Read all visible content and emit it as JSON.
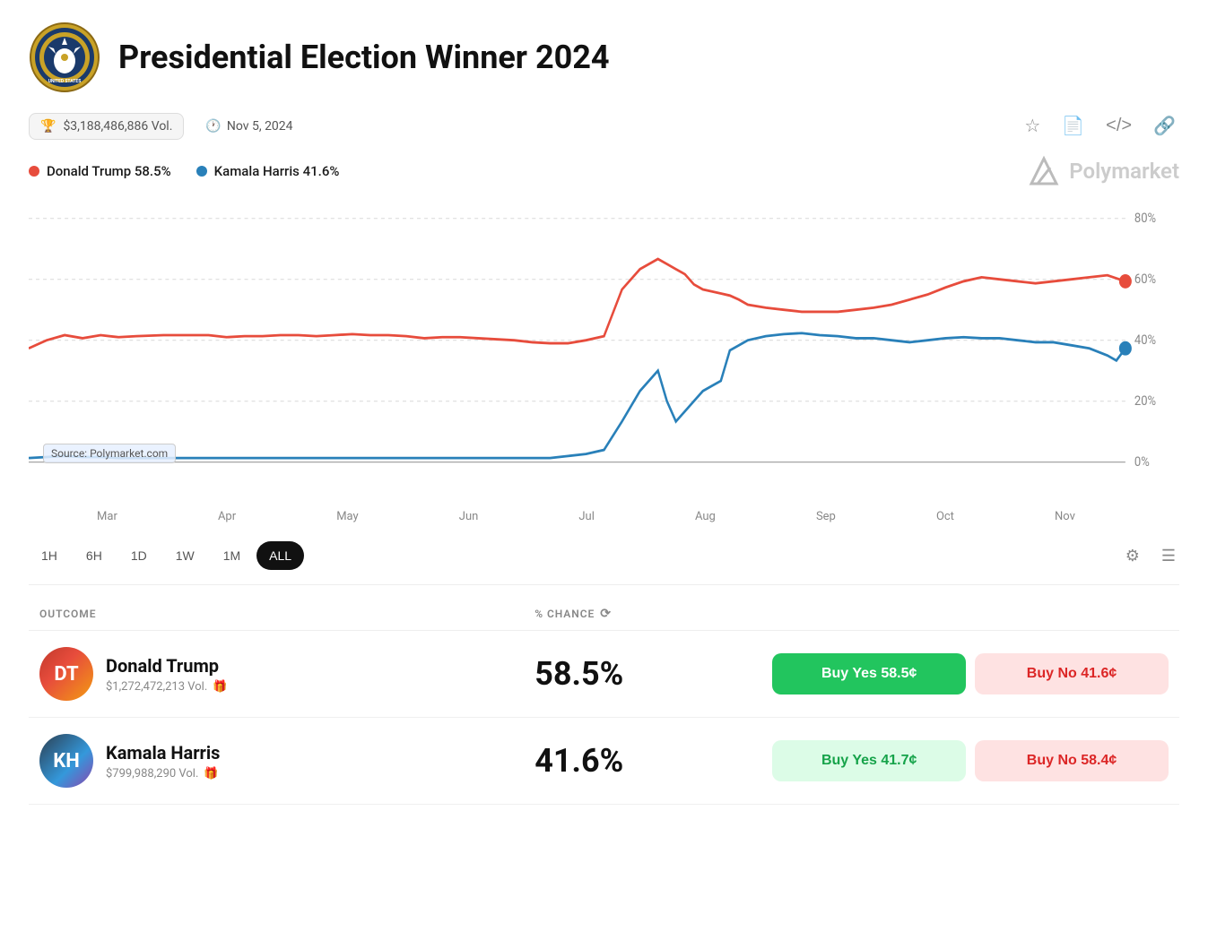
{
  "header": {
    "title": "Presidential Election Winner 2024",
    "volume": "$3,188,486,886 Vol.",
    "date": "Nov 5, 2024"
  },
  "legend": {
    "trump_label": "Donald Trump 58.5%",
    "harris_label": "Kamala Harris 41.6%",
    "trump_color": "#e74c3c",
    "harris_color": "#2980b9",
    "brand": "Polymarket"
  },
  "chart": {
    "source_label": "Source: Polymarket.com",
    "x_labels": [
      "Mar",
      "Apr",
      "May",
      "Jun",
      "Jul",
      "Aug",
      "Sep",
      "Oct",
      "Nov"
    ],
    "y_labels": [
      "80%",
      "60%",
      "40%",
      "20%",
      "0%"
    ]
  },
  "time_controls": {
    "buttons": [
      "1H",
      "6H",
      "1D",
      "1W",
      "1M",
      "ALL"
    ],
    "active": "ALL"
  },
  "table": {
    "outcome_header": "OUTCOME",
    "chance_header": "% CHANCE",
    "rows": [
      {
        "name": "Donald Trump",
        "volume": "$1,272,472,213 Vol.",
        "chance": "58.5%",
        "buy_yes": "Buy Yes 58.5¢",
        "buy_no": "Buy No 41.6¢"
      },
      {
        "name": "Kamala Harris",
        "volume": "$799,988,290 Vol.",
        "chance": "41.6%",
        "buy_yes": "Buy Yes 41.7¢",
        "buy_no": "Buy No 58.4¢"
      }
    ]
  }
}
